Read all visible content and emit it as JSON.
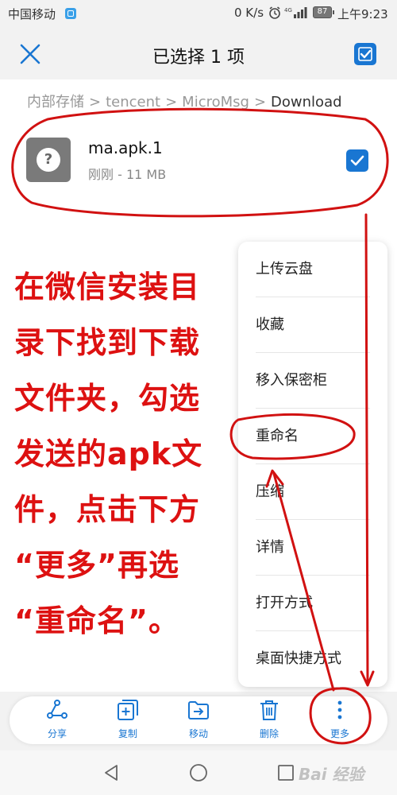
{
  "status_bar": {
    "carrier": "中国移动",
    "net_speed": "0 K/s",
    "battery": "87",
    "time": "上午9:23"
  },
  "title_bar": {
    "title": "已选择 1 项"
  },
  "breadcrumb": [
    "内部存储",
    "tencent",
    "MicroMsg",
    "Download"
  ],
  "file": {
    "name": "ma.apk.1",
    "meta": "刚刚 - 11 MB",
    "icon_glyph": "?",
    "checked": true
  },
  "instruction": {
    "lines": [
      "在微信安装目",
      "录下找到下载",
      "文件夹，勾选",
      "发送的apk文",
      "件，点击下方",
      "“更多”再选",
      "“重命名”。"
    ]
  },
  "menu": {
    "items": [
      "上传云盘",
      "收藏",
      "移入保密柜",
      "重命名",
      "压缩",
      "详情",
      "打开方式",
      "桌面快捷方式"
    ]
  },
  "toolbar": {
    "share": "分享",
    "copy": "复制",
    "move": "移动",
    "delete": "删除",
    "more": "更多"
  },
  "watermark": "Bai 经验",
  "colors": {
    "accent": "#1976d2",
    "annotation": "#d11111"
  }
}
